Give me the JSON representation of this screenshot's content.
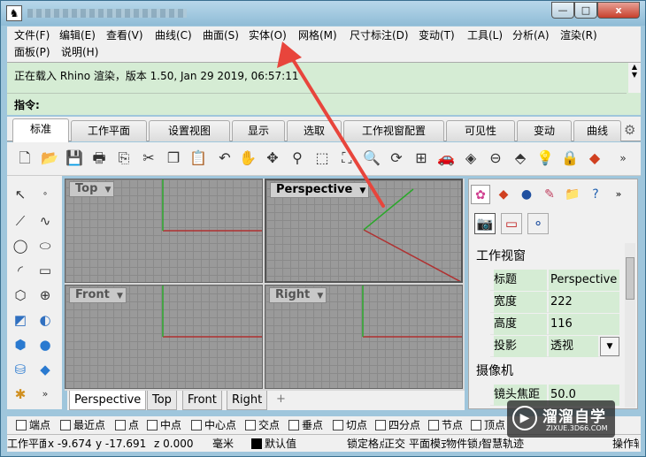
{
  "window": {
    "app_icon": "rhino-icon",
    "minimize_glyph": "—",
    "maximize_glyph": "□",
    "close_glyph": "x"
  },
  "menu": {
    "items": [
      "文件(F)",
      "编辑(E)",
      "查看(V)",
      "曲线(C)",
      "曲面(S)",
      "实体(O)",
      "网格(M)",
      "尺寸标注(D)",
      "变动(T)",
      "工具(L)",
      "分析(A)",
      "渲染(R)",
      "面板(P)",
      "说明(H)"
    ]
  },
  "command": {
    "history": "正在载入 Rhino 渲染，版本 1.50, Jan 29 2019, 06:57:11",
    "prompt_label": "指令:",
    "input_value": ""
  },
  "tabs": {
    "items": [
      "标准",
      "工作平面",
      "设置视图",
      "显示",
      "选取",
      "工作视窗配置",
      "可见性",
      "变动",
      "曲线"
    ],
    "active": "标准"
  },
  "toolbar": {
    "icons": [
      "new-file-icon",
      "open-folder-icon",
      "save-icon",
      "print-icon",
      "import-icon",
      "cut-icon",
      "copy-icon",
      "paste-icon",
      "undo-icon",
      "pan-hand-icon",
      "rotate-view-icon",
      "zoom-icon",
      "zoom-window-icon",
      "zoom-extents-icon",
      "zoom-selected-icon",
      "rotate-icon",
      "four-viewports-icon",
      "car-icon",
      "render-icon",
      "circle-icon",
      "select-icon",
      "light-bulb-icon",
      "lock-icon",
      "material-icon",
      "more-icon"
    ]
  },
  "side_toolbar": {
    "icons": [
      "arrow-select-icon",
      "point-icon",
      "polyline-icon",
      "curve-icon",
      "circle-icon",
      "ellipse-icon",
      "arc-icon",
      "rectangle-icon",
      "polygon-icon",
      "text-icon",
      "surface-icon",
      "blend-icon",
      "box-icon",
      "sphere-icon",
      "cylinder-icon",
      "mesh-icon",
      "gear-tools-icon",
      "expand-icon"
    ]
  },
  "viewports": {
    "top": "Top",
    "perspective": "Perspective",
    "front": "Front",
    "right": "Right"
  },
  "viewport_tabs": {
    "items": [
      "Perspective",
      "Top",
      "Front",
      "Right"
    ],
    "active": "Perspective",
    "add_glyph": "+"
  },
  "panel": {
    "tab_icons": [
      "color-wheel-icon",
      "layers-icon",
      "materials-icon",
      "brush-icon",
      "folder-icon",
      "help-icon"
    ],
    "sub_icons": [
      "camera-icon",
      "frame-icon",
      "spheres-icon"
    ],
    "section_viewport": "工作视窗",
    "rows": [
      {
        "key": "标题",
        "value": "Perspective"
      },
      {
        "key": "宽度",
        "value": "222"
      },
      {
        "key": "高度",
        "value": "116"
      },
      {
        "key": "投影",
        "value": "透视"
      }
    ],
    "section_camera": "摄像机",
    "camera_row": {
      "key": "镜头焦距",
      "value": "50.0"
    }
  },
  "osnap": {
    "items": [
      "端点",
      "最近点",
      "点",
      "中点",
      "中心点",
      "交点",
      "垂点",
      "切点",
      "四分点",
      "节点",
      "顶点"
    ]
  },
  "status": {
    "cplane": "工作平面",
    "x": "x -9.674",
    "y": "y -17.691",
    "z": "z 0.000",
    "unit": "毫米",
    "layer": "默认值",
    "lock_grid": "锁定格点",
    "ortho": "正交",
    "planar": "平面模式",
    "osnap": "物件锁点",
    "smart_track": "智慧轨迹",
    "gumball": "操作轴"
  },
  "watermark": {
    "text": "溜溜自学",
    "sub": "ZIXUE.3D66.COM"
  },
  "colors": {
    "command_bg": "#d5ecd4",
    "accent_arrow": "#e8453c",
    "axis_red": "#b03030",
    "axis_green": "#2aa82a"
  }
}
